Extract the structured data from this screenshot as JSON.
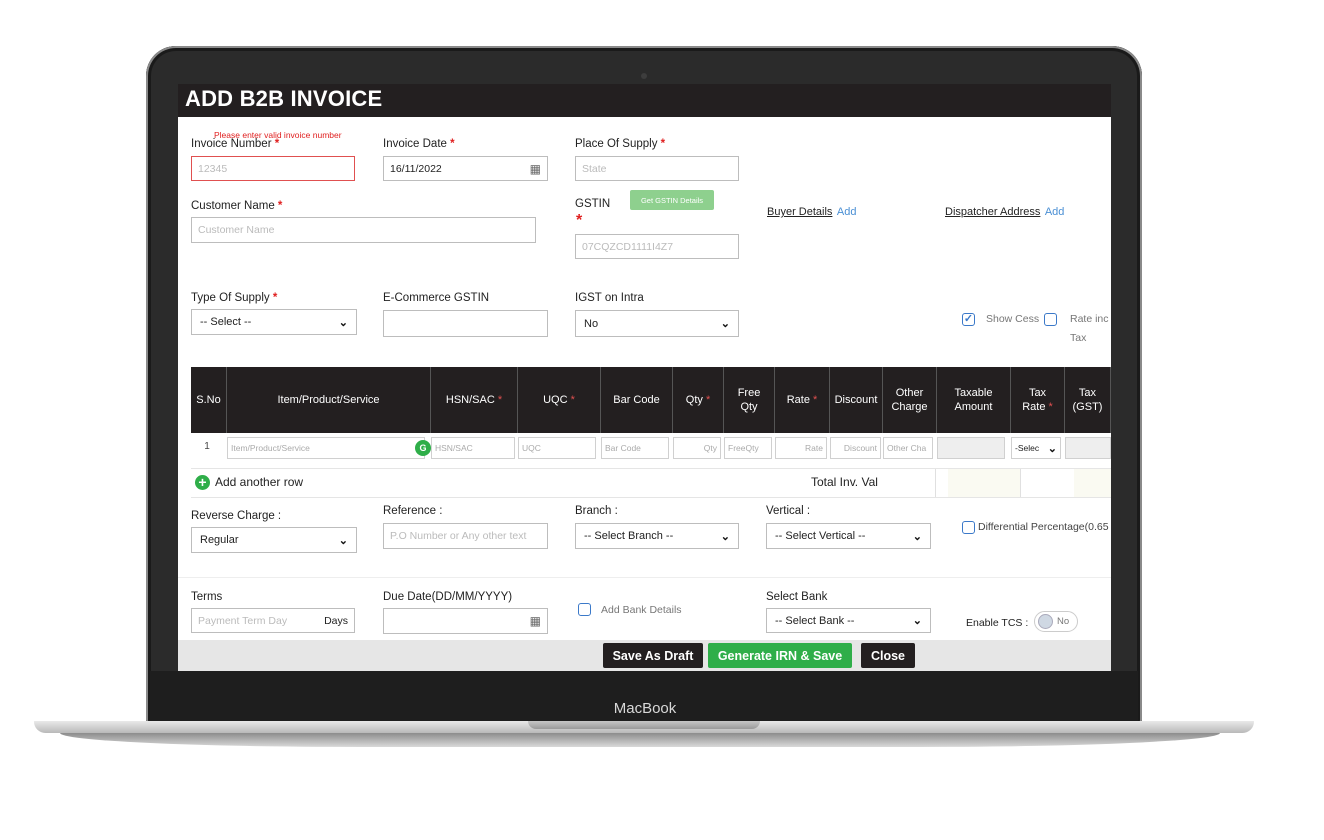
{
  "device_label": "MacBook",
  "invoice": {
    "title": "ADD B2B INVOICE",
    "invoice_number": {
      "label": "Invoice Number",
      "error": "Please enter valid invoice number",
      "placeholder": "12345"
    },
    "invoice_date": {
      "label": "Invoice Date",
      "value": "16/11/2022"
    },
    "place_of_supply": {
      "label": "Place Of Supply",
      "placeholder": "State"
    },
    "customer_name": {
      "label": "Customer Name",
      "placeholder": "Customer Name"
    },
    "gstin": {
      "label": "GSTIN",
      "button": "Get GSTIN Details",
      "placeholder": "07CQZCD1111I4Z7"
    },
    "buyer_details": {
      "label": "Buyer Details",
      "action": "Add"
    },
    "dispatcher_address": {
      "label": "Dispatcher Address",
      "action": "Add"
    },
    "type_of_supply": {
      "label": "Type Of Supply",
      "selected": "-- Select --"
    },
    "ecommerce_gstin": {
      "label": "E-Commerce GSTIN"
    },
    "igst_on_intra": {
      "label": "IGST on Intra",
      "selected": "No"
    },
    "show_cess": {
      "label": "Show Cess",
      "checked": true
    },
    "rate_incl_tax": {
      "label_line1": "Rate inc",
      "label_line2": "Tax",
      "checked": false
    },
    "required_mark": "*"
  },
  "table": {
    "headers": [
      {
        "line1": "S.No",
        "line2": "",
        "required": false
      },
      {
        "line1": "Item/Product/Service",
        "line2": "",
        "required": false
      },
      {
        "line1": "HSN/SAC",
        "line2": "",
        "required": true
      },
      {
        "line1": "UQC",
        "line2": "",
        "required": true
      },
      {
        "line1": "Bar Code",
        "line2": "",
        "required": false
      },
      {
        "line1": "Qty",
        "line2": "",
        "required": true
      },
      {
        "line1": "Free",
        "line2": "Qty",
        "required": false
      },
      {
        "line1": "Rate",
        "line2": "",
        "required": true
      },
      {
        "line1": "Discount",
        "line2": "",
        "required": false
      },
      {
        "line1": "Other",
        "line2": "Charge",
        "required": false
      },
      {
        "line1": "Taxable",
        "line2": "Amount",
        "required": false
      },
      {
        "line1": "Tax",
        "line2": "Rate",
        "required": true
      },
      {
        "line1": "Tax",
        "line2": "(GST)",
        "required": false
      }
    ],
    "row": {
      "sno": "1",
      "item": "Item/Product/Service",
      "item_icon_letter": "G",
      "hsn": "HSN/SAC",
      "uqc": "UQC",
      "barcode": "Bar Code",
      "qty": "Qty",
      "free_qty": "FreeQty",
      "rate": "Rate",
      "discount": "Discount",
      "other_charge": "Other Cha",
      "tax_rate": "-Selec"
    },
    "add_row": "Add another row",
    "total_label": "Total Inv. Val"
  },
  "footer_fields": {
    "reverse_charge": {
      "label": "Reverse Charge :",
      "selected": "Regular"
    },
    "reference": {
      "label": "Reference :",
      "placeholder": "P.O Number or Any other text"
    },
    "branch": {
      "label": "Branch :",
      "selected": "-- Select Branch --"
    },
    "vertical": {
      "label": "Vertical :",
      "selected": "-- Select Vertical --"
    },
    "differential": {
      "label": "Differential Percentage(0.65"
    },
    "terms": {
      "label": "Terms",
      "placeholder": "Payment Term Day",
      "suffix": "Days"
    },
    "due_date": {
      "label": "Due Date(DD/MM/YYYY)"
    },
    "add_bank": {
      "label": "Add Bank Details"
    },
    "select_bank": {
      "label": "Select Bank",
      "selected": "-- Select Bank --"
    },
    "enable_tcs": {
      "label": "Enable TCS :",
      "toggle": "No"
    }
  },
  "actions": {
    "save_draft": "Save As Draft",
    "generate": "Generate IRN & Save",
    "close": "Close"
  },
  "colors": {
    "header": "#231f20",
    "green": "#2fae49",
    "error": "#e02020",
    "link": "#4a8fd4"
  }
}
